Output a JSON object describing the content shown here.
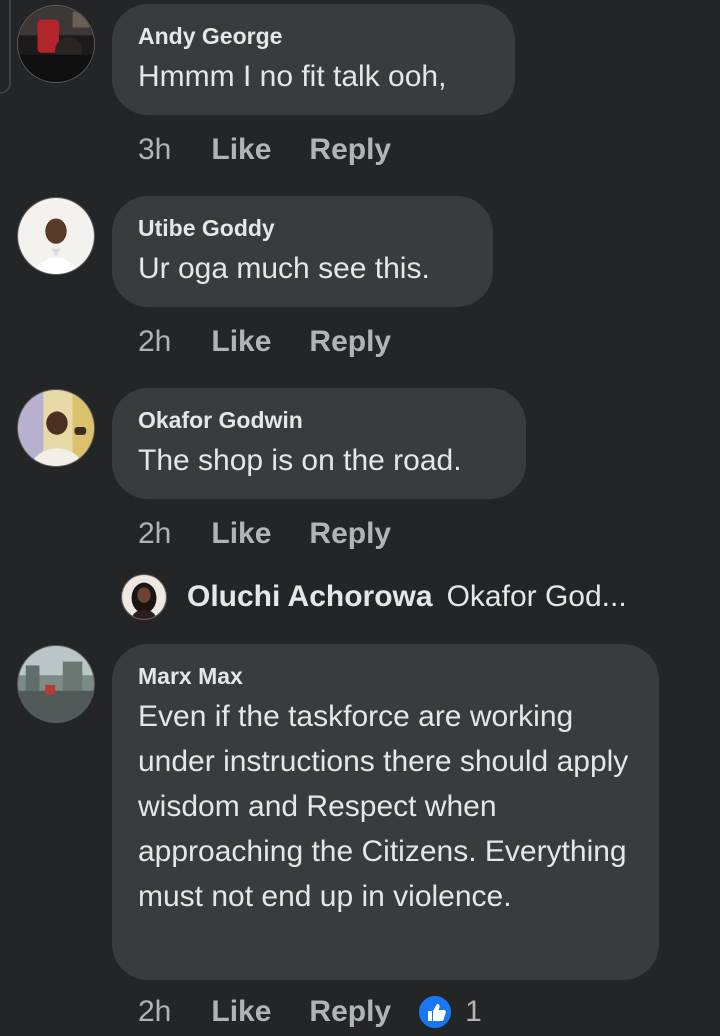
{
  "comments": [
    {
      "author": "Andy George",
      "text": "Hmmm I no fit talk ooh,",
      "time": "3h",
      "like_label": "Like",
      "reply_label": "Reply"
    },
    {
      "author": "Utibe Goddy",
      "text": "Ur oga much see this.",
      "time": "2h",
      "like_label": "Like",
      "reply_label": "Reply"
    },
    {
      "author": "Okafor Godwin",
      "text": "The shop is on the road.",
      "time": "2h",
      "like_label": "Like",
      "reply_label": "Reply"
    },
    {
      "author": "Marx Max",
      "text": "Even if the taskforce are working under instructions there should apply wisdom and Respect when approaching the Citizens. Everything must not end up in violence.",
      "time": "2h",
      "like_label": "Like",
      "reply_label": "Reply",
      "reaction_count": "1",
      "reaction_icon": "thumbs-up-icon"
    }
  ],
  "reply_preview": {
    "author": "Oluchi Achorowa",
    "snippet": "Okafor God..."
  },
  "colors": {
    "background": "#242526",
    "bubble": "#3a3b3c",
    "text": "#e4e6eb",
    "muted": "#b0b3b8",
    "like_blue": "#1877f2"
  }
}
